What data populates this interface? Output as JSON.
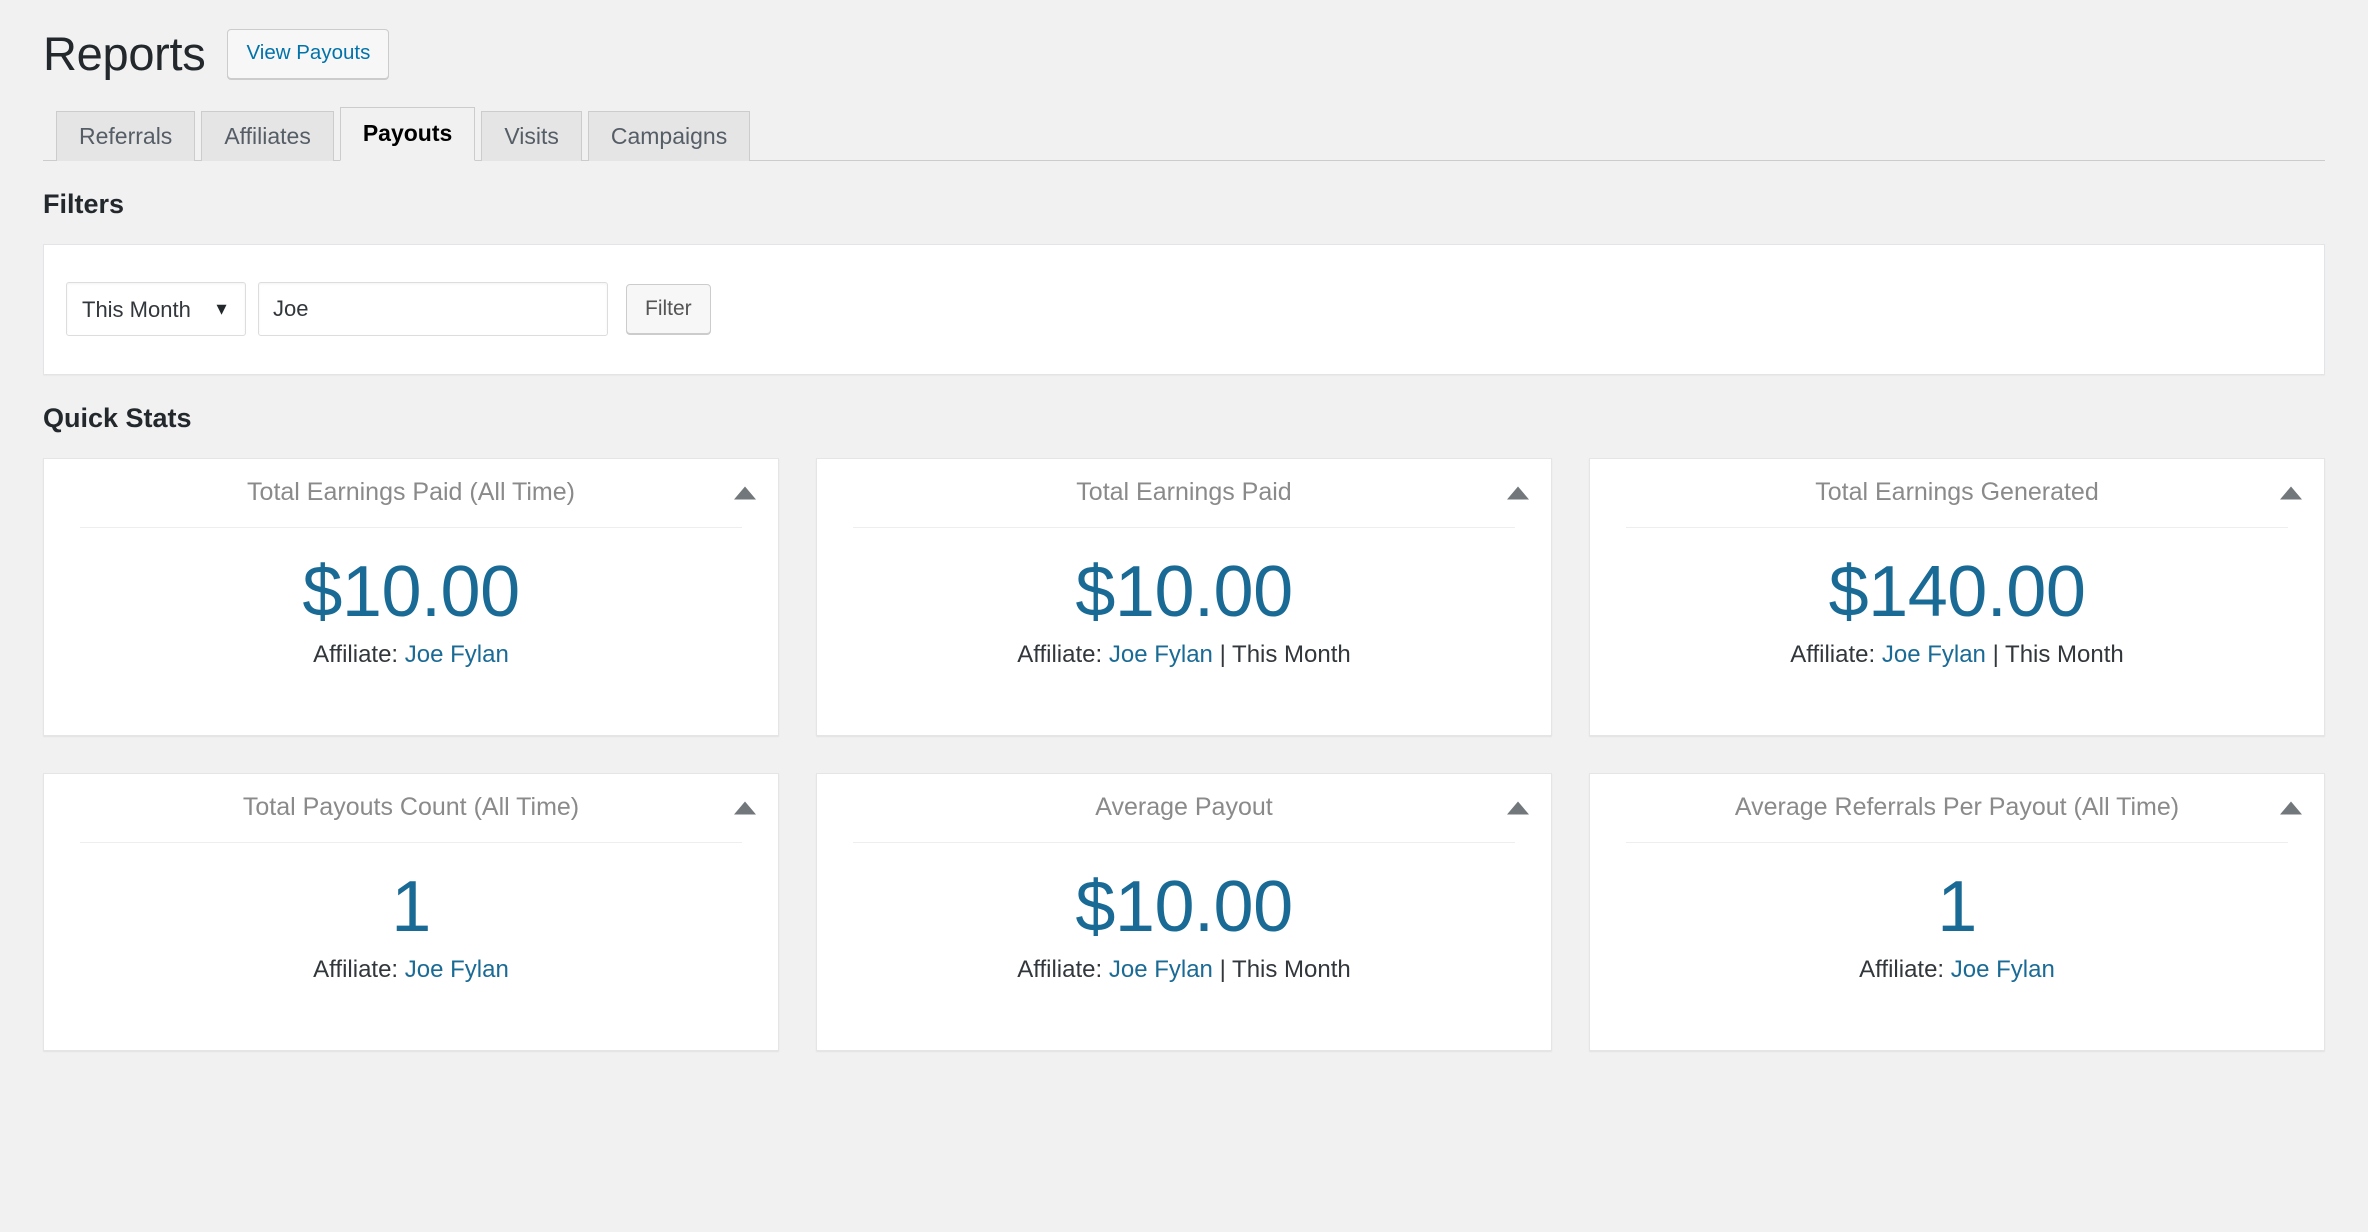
{
  "header": {
    "title": "Reports",
    "action_label": "View Payouts"
  },
  "tabs": [
    {
      "label": "Referrals",
      "active": false
    },
    {
      "label": "Affiliates",
      "active": false
    },
    {
      "label": "Payouts",
      "active": true
    },
    {
      "label": "Visits",
      "active": false
    },
    {
      "label": "Campaigns",
      "active": false
    }
  ],
  "filters": {
    "heading": "Filters",
    "date_range": {
      "selected": "This Month",
      "options": [
        "This Month"
      ],
      "arrow": "▼"
    },
    "search": {
      "value": "Joe",
      "placeholder": ""
    },
    "submit_label": "Filter"
  },
  "quick_stats": {
    "heading": "Quick Stats",
    "cards": [
      {
        "title": "Total Earnings Paid (All Time)",
        "value": "$10.00",
        "meta_prefix": "Affiliate:",
        "affiliate": "Joe Fylan",
        "meta_suffix": "",
        "toggle_icon": "caret-up-icon"
      },
      {
        "title": "Total Earnings Paid",
        "value": "$10.00",
        "meta_prefix": "Affiliate:",
        "affiliate": "Joe Fylan",
        "meta_suffix": " | This Month",
        "toggle_icon": "caret-up-icon"
      },
      {
        "title": "Total Earnings Generated",
        "value": "$140.00",
        "meta_prefix": "Affiliate:",
        "affiliate": "Joe Fylan",
        "meta_suffix": " | This Month",
        "toggle_icon": "caret-up-icon"
      },
      {
        "title": "Total Payouts Count (All Time)",
        "value": "1",
        "meta_prefix": "Affiliate:",
        "affiliate": "Joe Fylan",
        "meta_suffix": "",
        "toggle_icon": "caret-up-icon"
      },
      {
        "title": "Average Payout",
        "value": "$10.00",
        "meta_prefix": "Affiliate:",
        "affiliate": "Joe Fylan",
        "meta_suffix": " | This Month",
        "toggle_icon": "caret-up-icon"
      },
      {
        "title": "Average Referrals Per Payout (All Time)",
        "value": "1",
        "meta_prefix": "Affiliate:",
        "affiliate": "Joe Fylan",
        "meta_suffix": "",
        "toggle_icon": "caret-up-icon"
      }
    ]
  },
  "colors": {
    "accent_blue": "#1a6a96",
    "link_blue": "#0073aa",
    "page_bg": "#f1f1f1",
    "card_bg": "#ffffff",
    "muted_text": "#8a8a8a"
  }
}
